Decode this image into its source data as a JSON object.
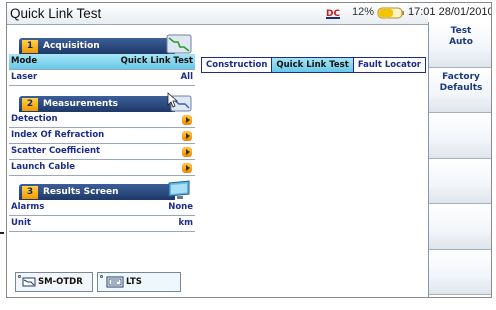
{
  "window": {
    "title": "Quick Link Test"
  },
  "status": {
    "battery_pct": "12%",
    "time": "17:01",
    "date": "28/01/2010"
  },
  "acquisition": {
    "number": "1",
    "title": "Acquisition",
    "rows": [
      {
        "label": "Mode",
        "value": "Quick Link Test",
        "selected": true
      },
      {
        "label": "Laser",
        "value": "All"
      }
    ]
  },
  "measurements": {
    "number": "2",
    "title": "Measurements",
    "rows": [
      {
        "label": "Detection"
      },
      {
        "label": "Index Of Refraction"
      },
      {
        "label": "Scatter Coefficient"
      },
      {
        "label": "Launch Cable"
      }
    ]
  },
  "results": {
    "number": "3",
    "title": "Results Screen",
    "rows": [
      {
        "label": "Alarms",
        "value": "None"
      },
      {
        "label": "Unit",
        "value": "km"
      }
    ]
  },
  "mode_options": [
    {
      "label": "Construction"
    },
    {
      "label": "Quick Link Test",
      "active": true
    },
    {
      "label": "Fault Locator"
    }
  ],
  "side_buttons": [
    {
      "line1": "Test",
      "line2": "Auto"
    },
    {
      "line1": "Factory",
      "line2": "Defaults"
    },
    {
      "line1": "",
      "line2": ""
    },
    {
      "line1": "",
      "line2": ""
    },
    {
      "line1": "",
      "line2": ""
    },
    {
      "line1": "",
      "line2": ""
    }
  ],
  "bottom_tabs": [
    {
      "label": "SM-OTDR",
      "icon": "otdr-module-icon"
    },
    {
      "label": "LTS",
      "icon": "lts-module-icon"
    }
  ],
  "colors": {
    "header_blue": "#1e3866",
    "accent_orange": "#f29a00",
    "highlight_cyan": "#67c9e9",
    "text_blue": "#1c2c8c"
  }
}
